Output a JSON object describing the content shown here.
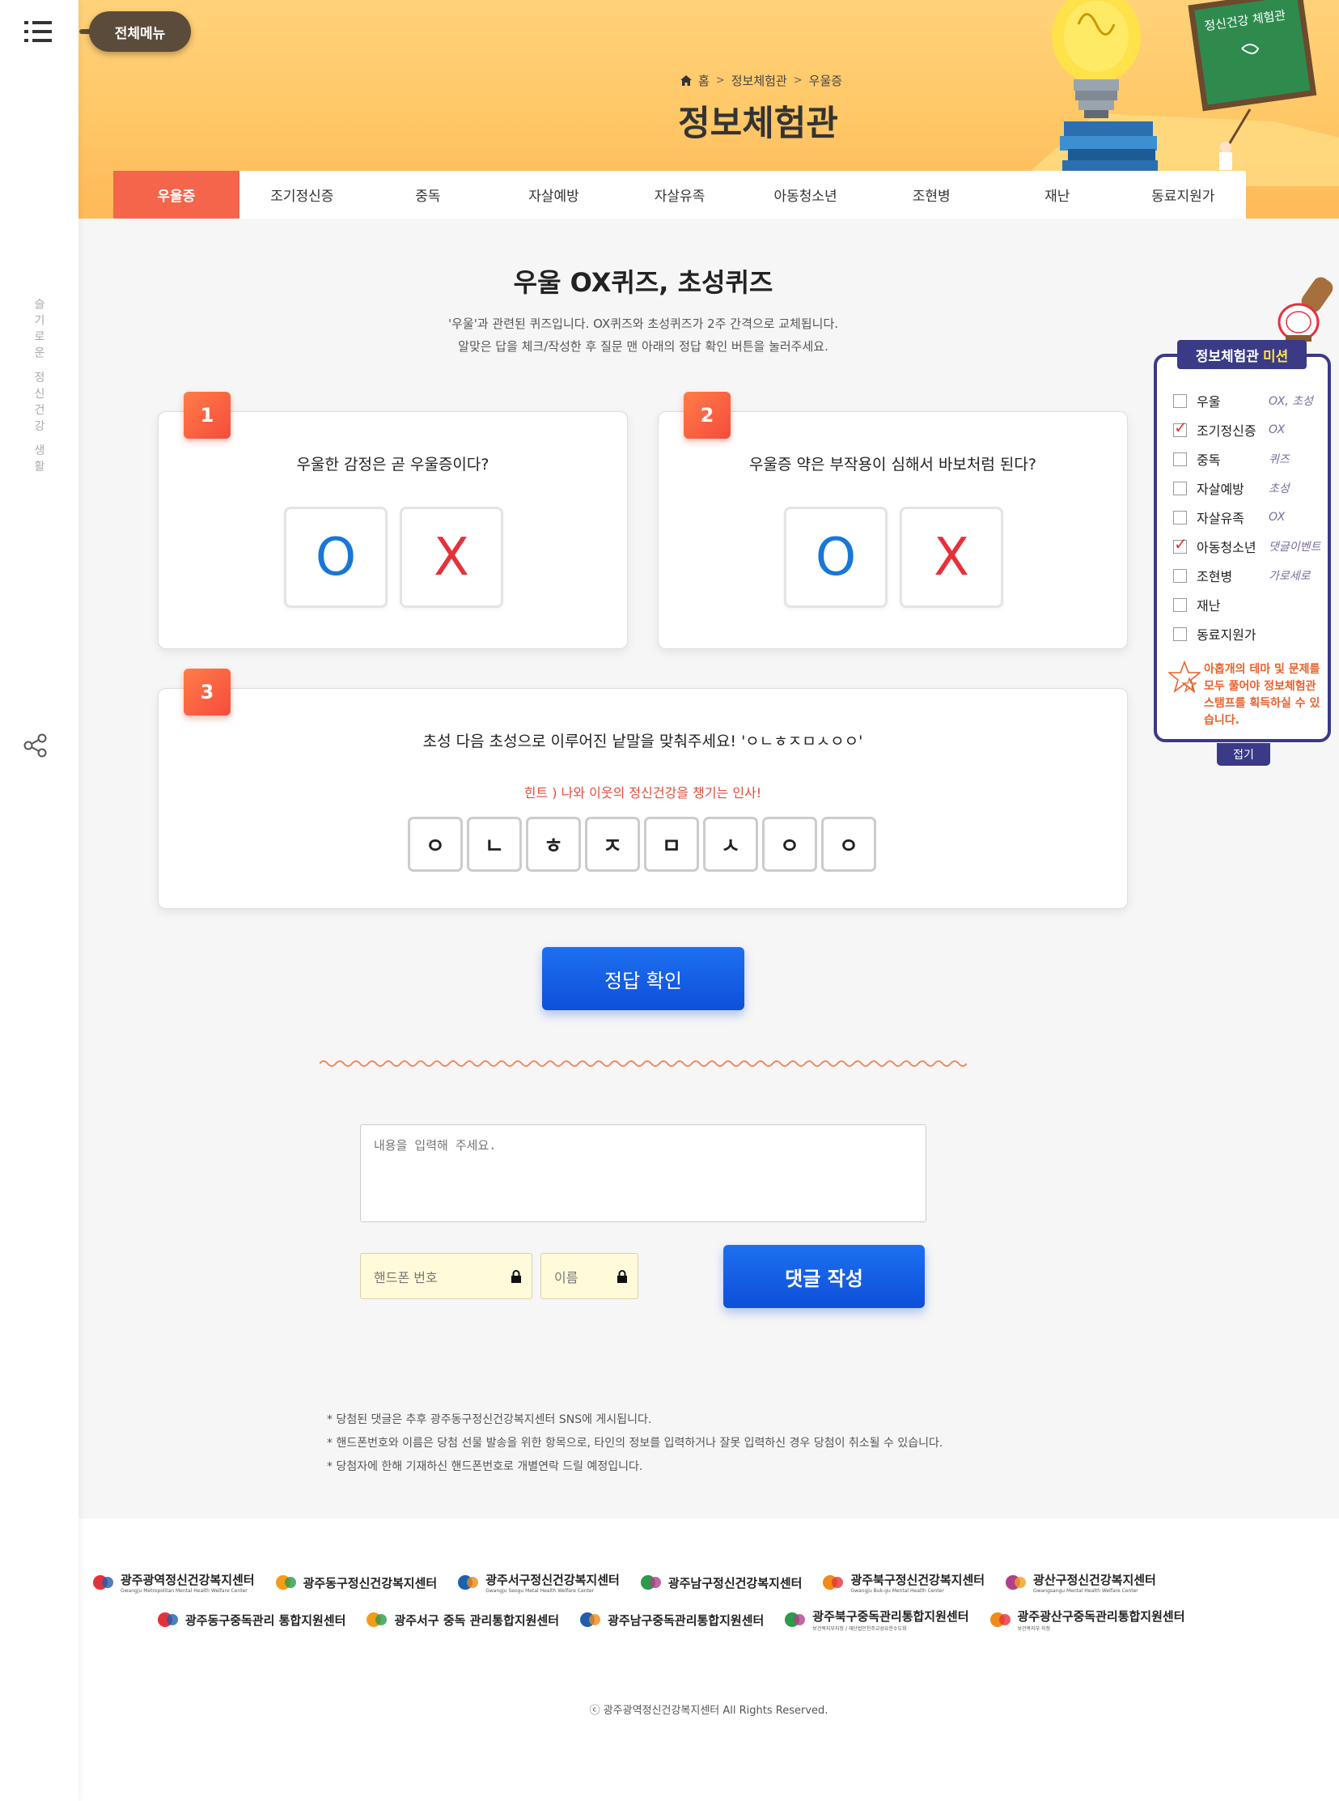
{
  "rail": {
    "vertical_text": "슬기로운 정신건강 생활"
  },
  "header": {
    "all_menu": "전체메뉴",
    "breadcrumb": {
      "home": "홈",
      "level1": "정보체험관",
      "level2": "우울증"
    },
    "title": "정보체험관",
    "deco_board_text": "정신건강 체험관"
  },
  "tabs": [
    "우울증",
    "조기정신증",
    "중독",
    "자살예방",
    "자살유족",
    "아동청소년",
    "조현병",
    "재난",
    "동료지원가"
  ],
  "quiz": {
    "title": "우울 OX퀴즈, 초성퀴즈",
    "desc_line1": "'우울'과 관련된 퀴즈입니다. OX퀴즈와 초성퀴즈가 2주 간격으로 교체됩니다.",
    "desc_line2": "알맞은 답을 체크/작성한 후 질문 맨 아래의 정답 확인 버튼을 눌러주세요.",
    "q1": {
      "num": "1",
      "text": "우울한 감정은 곧 우울증이다?",
      "o": "O",
      "x": "X"
    },
    "q2": {
      "num": "2",
      "text": "우울증 약은 부작용이 심해서 바보처럼 된다?",
      "o": "O",
      "x": "X"
    },
    "q3": {
      "num": "3",
      "text": "초성 다음 초성으로 이루어진 낱말을 맞춰주세요! 'ㅇㄴㅎㅈㅁㅅㅇㅇ'",
      "hint": "힌트 ) 나와 이웃의 정신건강을 챙기는 인사!",
      "letters": [
        "ㅇ",
        "ㄴ",
        "ㅎ",
        "ㅈ",
        "ㅁ",
        "ㅅ",
        "ㅇ",
        "ㅇ"
      ]
    },
    "check_button": "정답 확인"
  },
  "comment": {
    "placeholder": "내용을 입력해 주세요.",
    "phone_placeholder": "핸드폰 번호",
    "name_placeholder": "이름",
    "submit": "댓글 작성",
    "notes": [
      "* 당첨된 댓글은 추후 광주동구정신건강복지센터 SNS에 게시됩니다.",
      "* 핸드폰번호와 이름은 당첨 선물 발송을 위한 항목으로, 타인의 정보를 입력하거나 잘못 입력하신 경우 당첨이 취소될 수 있습니다.",
      "* 당첨자에 한해 기재하신 핸드폰번호로 개별연락 드릴 예정입니다."
    ]
  },
  "mission": {
    "title": "정보체험관",
    "title_highlight": "미션",
    "items": [
      {
        "label": "우울",
        "checked": false,
        "tag": "OX, 초성"
      },
      {
        "label": "조기정신증",
        "checked": true,
        "tag": "OX"
      },
      {
        "label": "중독",
        "checked": false,
        "tag": "퀴즈"
      },
      {
        "label": "자살예방",
        "checked": false,
        "tag": "초성"
      },
      {
        "label": "자살유족",
        "checked": false,
        "tag": "OX"
      },
      {
        "label": "아동청소년",
        "checked": true,
        "tag": "댓글이벤트"
      },
      {
        "label": "조현병",
        "checked": false,
        "tag": "가로세로"
      },
      {
        "label": "재난",
        "checked": false,
        "tag": ""
      },
      {
        "label": "동료지원가",
        "checked": false,
        "tag": ""
      }
    ],
    "note": "아홉개의 테마 및 문제를 모두 풀어야 정보체험관 스탬프를 획득하실 수 있습니다.",
    "fold": "접기"
  },
  "footer": {
    "logos_row1": [
      {
        "ko": "광주광역정신건강복지센터",
        "en": "Gwangju Metropolitan Mental Health Welfare Center"
      },
      {
        "ko": "광주동구정신건강복지센터",
        "en": ""
      },
      {
        "ko": "광주서구정신건강복지센터",
        "en": "Gwangju Seogu Metal Health Welfare Center"
      },
      {
        "ko": "광주남구정신건강복지센터",
        "en": ""
      },
      {
        "ko": "광주북구정신건강복지센터",
        "en": "Gwangju Buk-gu Mental Health Center"
      },
      {
        "ko": "광산구정신건강복지센터",
        "en": "Gwangsangu Mental Health Welfare Center"
      }
    ],
    "logos_row2": [
      {
        "ko": "광주동구중독관리 통합지원센터",
        "en": ""
      },
      {
        "ko": "광주서구 중독 관리통합지원센터",
        "en": ""
      },
      {
        "ko": "광주남구중독관리통합지원센터",
        "en": ""
      },
      {
        "ko": "광주북구중독관리통합지원센터",
        "en": "보건복지부지정 / 재단법인천주교성요한수도회"
      },
      {
        "ko": "광주광산구중독관리통합지원센터",
        "en": "보건복지부 지정"
      }
    ],
    "copyright": "ⓒ 광주광역정신건강복지센터 All Rights Reserved."
  },
  "colors": {
    "accent": "#f5654b",
    "primary_button": "#0d4fd9",
    "mission": "#3a3a86",
    "o_mark": "#1877d8",
    "x_mark": "#e5323a"
  }
}
